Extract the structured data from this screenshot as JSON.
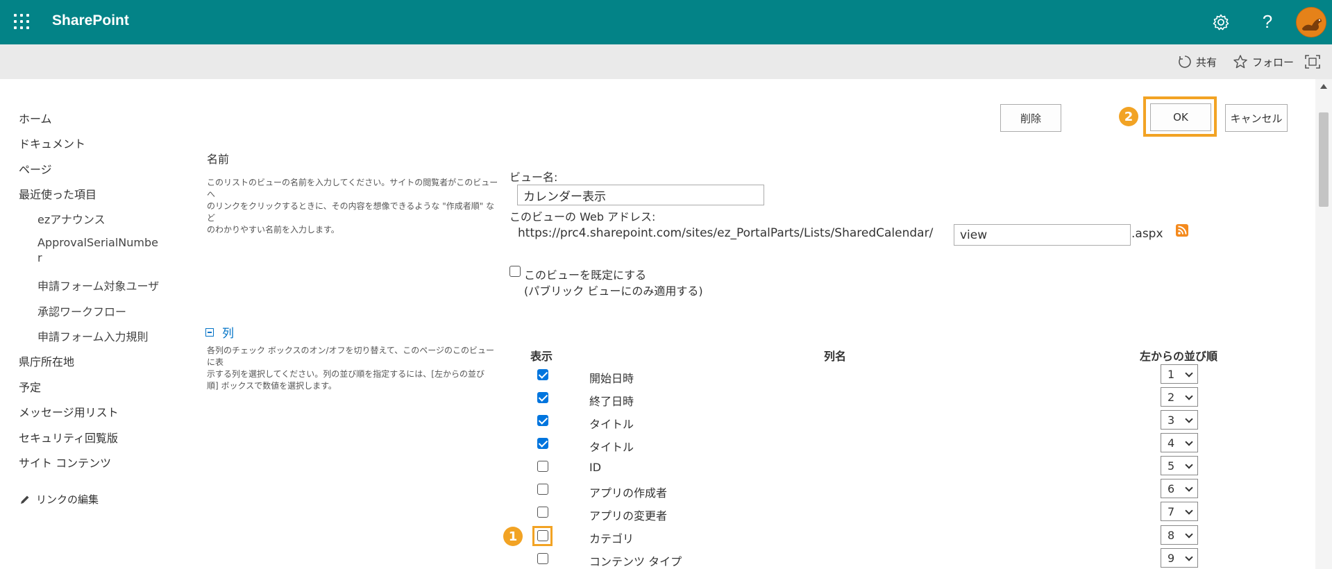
{
  "suite": {
    "brand": "SharePoint",
    "help": "?",
    "accent": "#038387"
  },
  "cmdbar": {
    "share": "共有",
    "follow": "フォロー"
  },
  "nav": {
    "items": [
      {
        "label": "ホーム",
        "level": 0
      },
      {
        "label": "ドキュメント",
        "level": 0
      },
      {
        "label": "ページ",
        "level": 0
      },
      {
        "label": "最近使った項目",
        "level": 0
      },
      {
        "label": "ezアナウンス",
        "level": 1
      },
      {
        "label": "ApprovalSerialNumbe",
        "level": 1
      },
      {
        "label": "r",
        "level": 1
      },
      {
        "label": "申請フォーム対象ユーザ",
        "level": 1
      },
      {
        "label": "承認ワークフロー",
        "level": 1
      },
      {
        "label": "申請フォーム入力規則",
        "level": 1
      },
      {
        "label": "県庁所在地",
        "level": 0
      },
      {
        "label": "予定",
        "level": 0
      },
      {
        "label": "メッセージ用リスト",
        "level": 0
      },
      {
        "label": "セキュリティ回覧版",
        "level": 0
      },
      {
        "label": "サイト コンテンツ",
        "level": 0
      }
    ],
    "edit_links": "リンクの編集"
  },
  "buttons": {
    "delete": "削除",
    "ok": "OK",
    "cancel": "キャンセル"
  },
  "badges": {
    "one": "1",
    "two": "2",
    "color": "#f2a324"
  },
  "name_section": {
    "title": "名前",
    "desc_lines": [
      "このリストのビューの名前を入力してください。サイトの閲覧者がこのビューへ",
      "のリンクをクリックするときに、その内容を想像できるような \"作成者順\" など",
      "のわかりやすい名前を入力します。"
    ],
    "view_name_label": "ビュー名:",
    "view_name_value": "カレンダー表示",
    "web_address_label": "このビューの Web アドレス:",
    "url_prefix": "https://prc4.sharepoint.com/sites/ez_PortalParts/Lists/SharedCalendar/",
    "url_value": "view",
    "url_suffix": ".aspx",
    "default_label": "このビューを既定にする",
    "default_sub": "(パブリック ビューにのみ適用する)"
  },
  "columns_section": {
    "title": "列",
    "desc_lines": [
      "各列のチェック ボックスのオン/オフを切り替えて、このページのこのビューに表",
      "示する列を選択してください。列の並び順を指定するには、[左からの並び",
      "順] ボックスで数値を選択します。"
    ],
    "headers": {
      "show": "表示",
      "name": "列名",
      "order": "左からの並び順"
    },
    "rows": [
      {
        "name": "開始日時",
        "checked": true,
        "order": "1"
      },
      {
        "name": "終了日時",
        "checked": true,
        "order": "2"
      },
      {
        "name": "タイトル",
        "checked": true,
        "order": "3"
      },
      {
        "name": "タイトル",
        "checked": true,
        "order": "4"
      },
      {
        "name": "ID",
        "checked": false,
        "order": "5"
      },
      {
        "name": "アプリの作成者",
        "checked": false,
        "order": "6"
      },
      {
        "name": "アプリの変更者",
        "checked": false,
        "order": "7"
      },
      {
        "name": "カテゴリ",
        "checked": false,
        "order": "8"
      },
      {
        "name": "コンテンツ タイプ",
        "checked": false,
        "order": "9"
      }
    ]
  }
}
